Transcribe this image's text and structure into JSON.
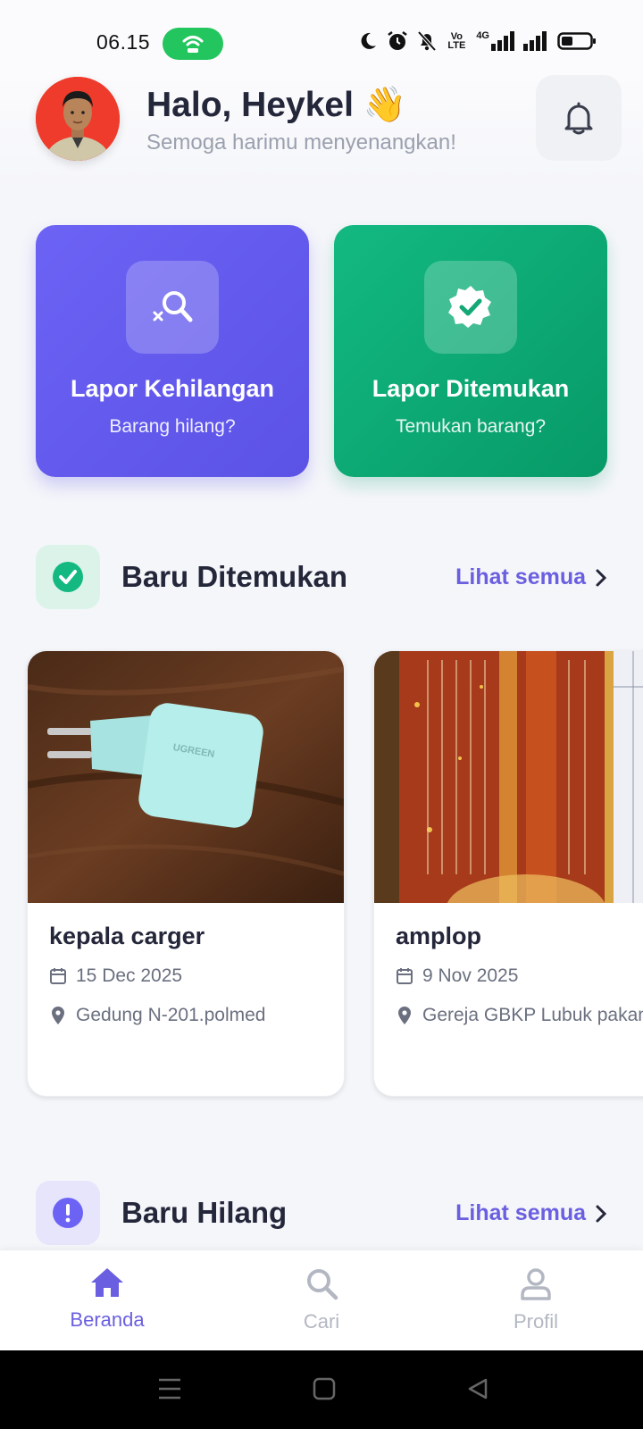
{
  "status_bar": {
    "time": "06.15",
    "volte_label": "Vo LTE",
    "network_label": "4G",
    "icons": [
      "hotspot-icon",
      "moon-icon",
      "alarm-icon",
      "bell-off-icon",
      "volte-icon",
      "signal-icon",
      "battery-icon"
    ]
  },
  "header": {
    "greeting": "Halo, Heykel 👋",
    "subtitle": "Semoga harimu menyenangkan!",
    "notification_icon": "bell-icon"
  },
  "actions": [
    {
      "title": "Lapor Kehilangan",
      "subtitle": "Barang hilang?",
      "icon": "search-x-icon",
      "color": "#6c63f5"
    },
    {
      "title": "Lapor Ditemukan",
      "subtitle": "Temukan barang?",
      "icon": "verified-badge-icon",
      "color": "#13b981"
    }
  ],
  "sections": {
    "found": {
      "title": "Baru Ditemukan",
      "link": "Lihat semua",
      "icon": "check-circle-icon",
      "color": "#13b981"
    },
    "lost": {
      "title": "Baru Hilang",
      "link": "Lihat semua",
      "icon": "alert-circle-icon",
      "color": "#6c63f5"
    }
  },
  "found_items": [
    {
      "title": "kepala carger",
      "date": "15 Dec 2025",
      "location": "Gedung N-201.polmed",
      "photo_text": "UGREEN"
    },
    {
      "title": "amplop",
      "date": "9 Nov 2025",
      "location": "Gereja GBKP Lubuk pakam"
    }
  ],
  "bottom_nav": [
    {
      "label": "Beranda",
      "icon": "home-icon",
      "active": true
    },
    {
      "label": "Cari",
      "icon": "search-icon",
      "active": false
    },
    {
      "label": "Profil",
      "icon": "user-icon",
      "active": false
    }
  ],
  "colors": {
    "accent": "#6a5fe0",
    "success": "#13b981",
    "text": "#24263a",
    "muted": "#9aa0ae"
  }
}
